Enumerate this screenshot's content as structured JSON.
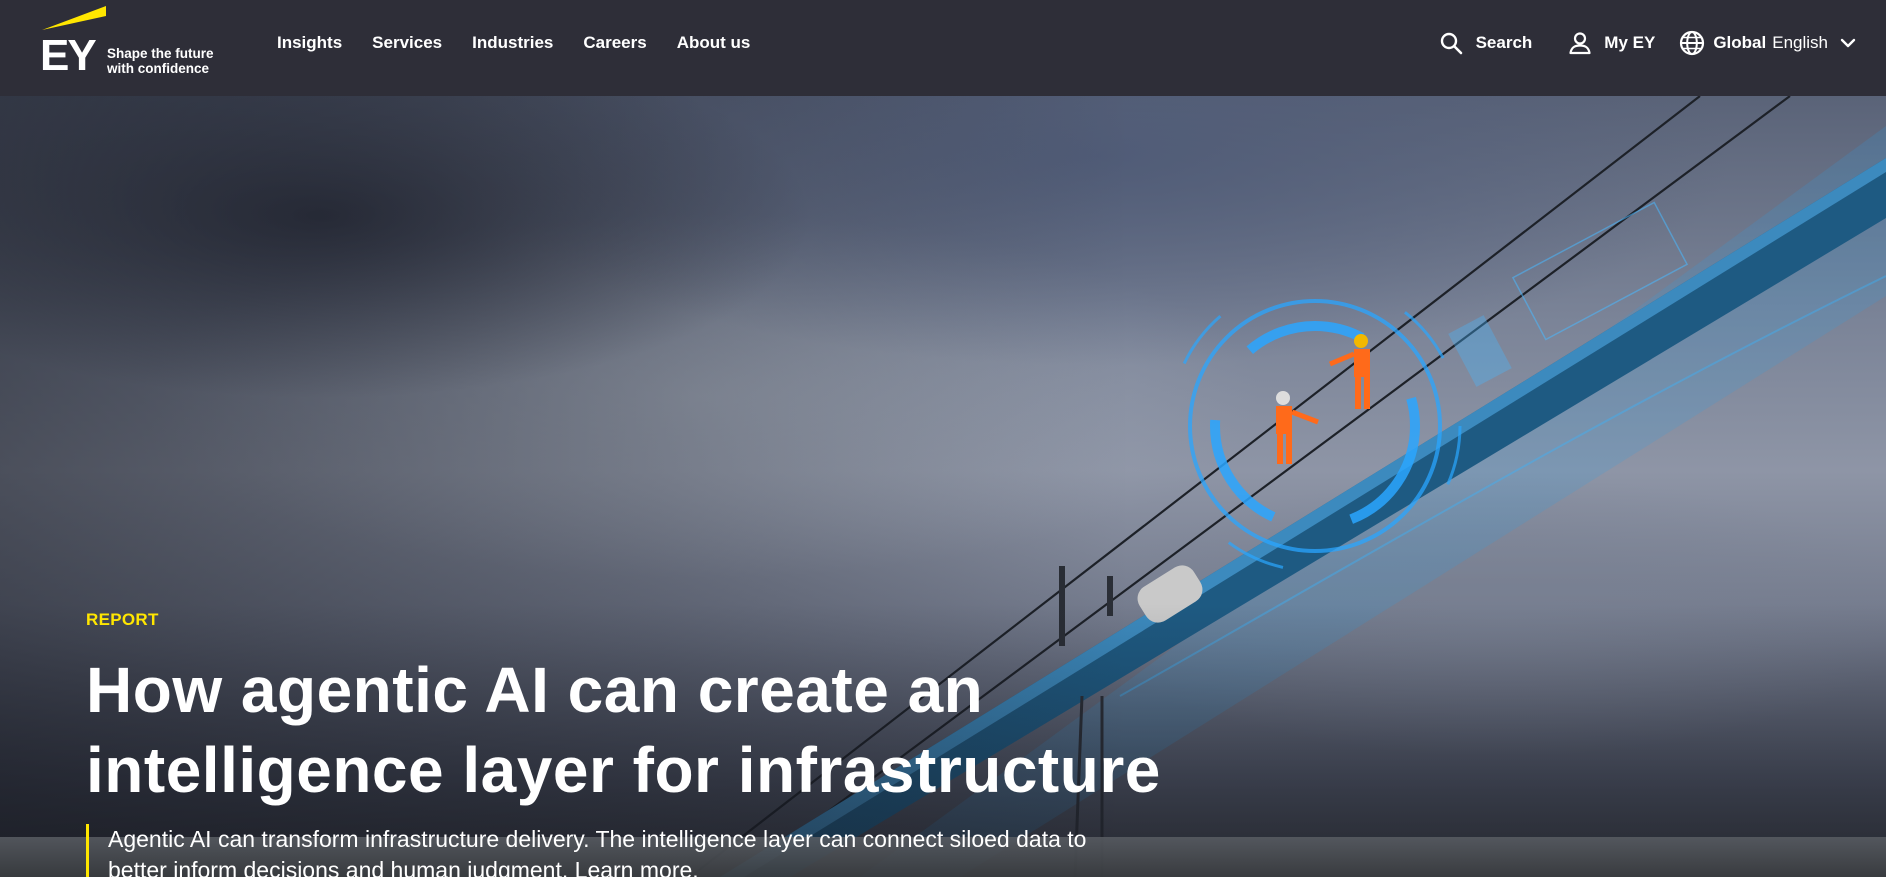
{
  "brand": {
    "logo_text": "EY",
    "tagline_line1": "Shape the future",
    "tagline_line2": "with confidence",
    "accent_color": "#ffe600"
  },
  "nav": {
    "items": [
      {
        "label": "Insights"
      },
      {
        "label": "Services"
      },
      {
        "label": "Industries"
      },
      {
        "label": "Careers"
      },
      {
        "label": "About us"
      }
    ]
  },
  "utilities": {
    "search_label": "Search",
    "search_icon": "search-icon",
    "myey_label": "My EY",
    "myey_icon": "user-icon",
    "region_label": "Global",
    "language_label": "English",
    "region_icon": "globe-icon"
  },
  "hero": {
    "eyebrow": "REPORT",
    "headline_line1": "How agentic AI can create an",
    "headline_line2": "intelligence layer for infrastructure",
    "lede_line1": "Agentic AI can transform infrastructure delivery. The intelligence layer can connect siloed data to",
    "lede_line2": "better inform decisions and human judgment. Learn more."
  }
}
